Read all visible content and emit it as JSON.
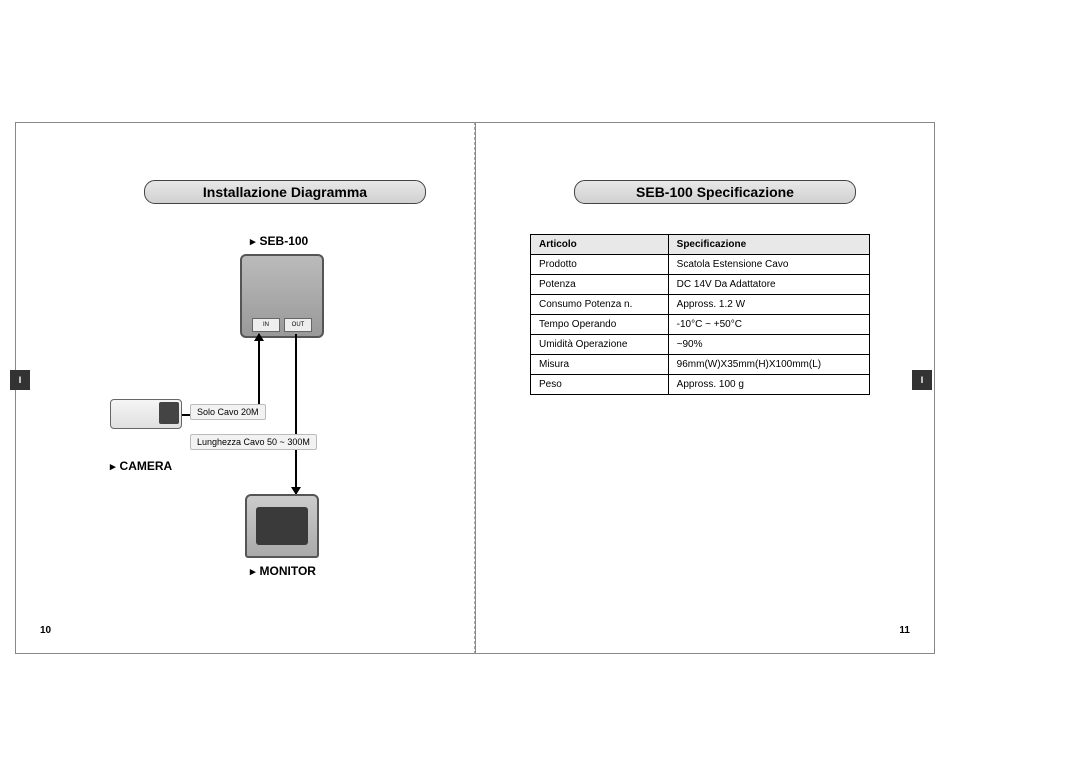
{
  "language_tab": "I",
  "left_page": {
    "title": "Installazione Diagramma",
    "diagram": {
      "seb_label": "SEB-100",
      "port_in": "IN",
      "port_out": "OUT",
      "cable_short": "Solo Cavo 20M",
      "cable_long": "Lunghezza Cavo 50 ~ 300M",
      "camera_label": "CAMERA",
      "monitor_label": "MONITOR"
    },
    "page_number": "10"
  },
  "right_page": {
    "title": "SEB-100 Specificazione",
    "table": {
      "headers": {
        "col1": "Articolo",
        "col2": "Specificazione"
      },
      "rows": [
        {
          "col1": "Prodotto",
          "col2": "Scatola Estensione Cavo"
        },
        {
          "col1": "Potenza",
          "col2": "DC 14V Da Adattatore"
        },
        {
          "col1": "Consumo Potenza n.",
          "col2": "Appross. 1.2 W"
        },
        {
          "col1": "Tempo Operando",
          "col2": "-10°C ~ +50°C"
        },
        {
          "col1": "Umidità Operazione",
          "col2": "~90%"
        },
        {
          "col1": "Misura",
          "col2": "96mm(W)X35mm(H)X100mm(L)"
        },
        {
          "col1": "Peso",
          "col2": "Appross. 100 g"
        }
      ]
    },
    "page_number": "11"
  }
}
